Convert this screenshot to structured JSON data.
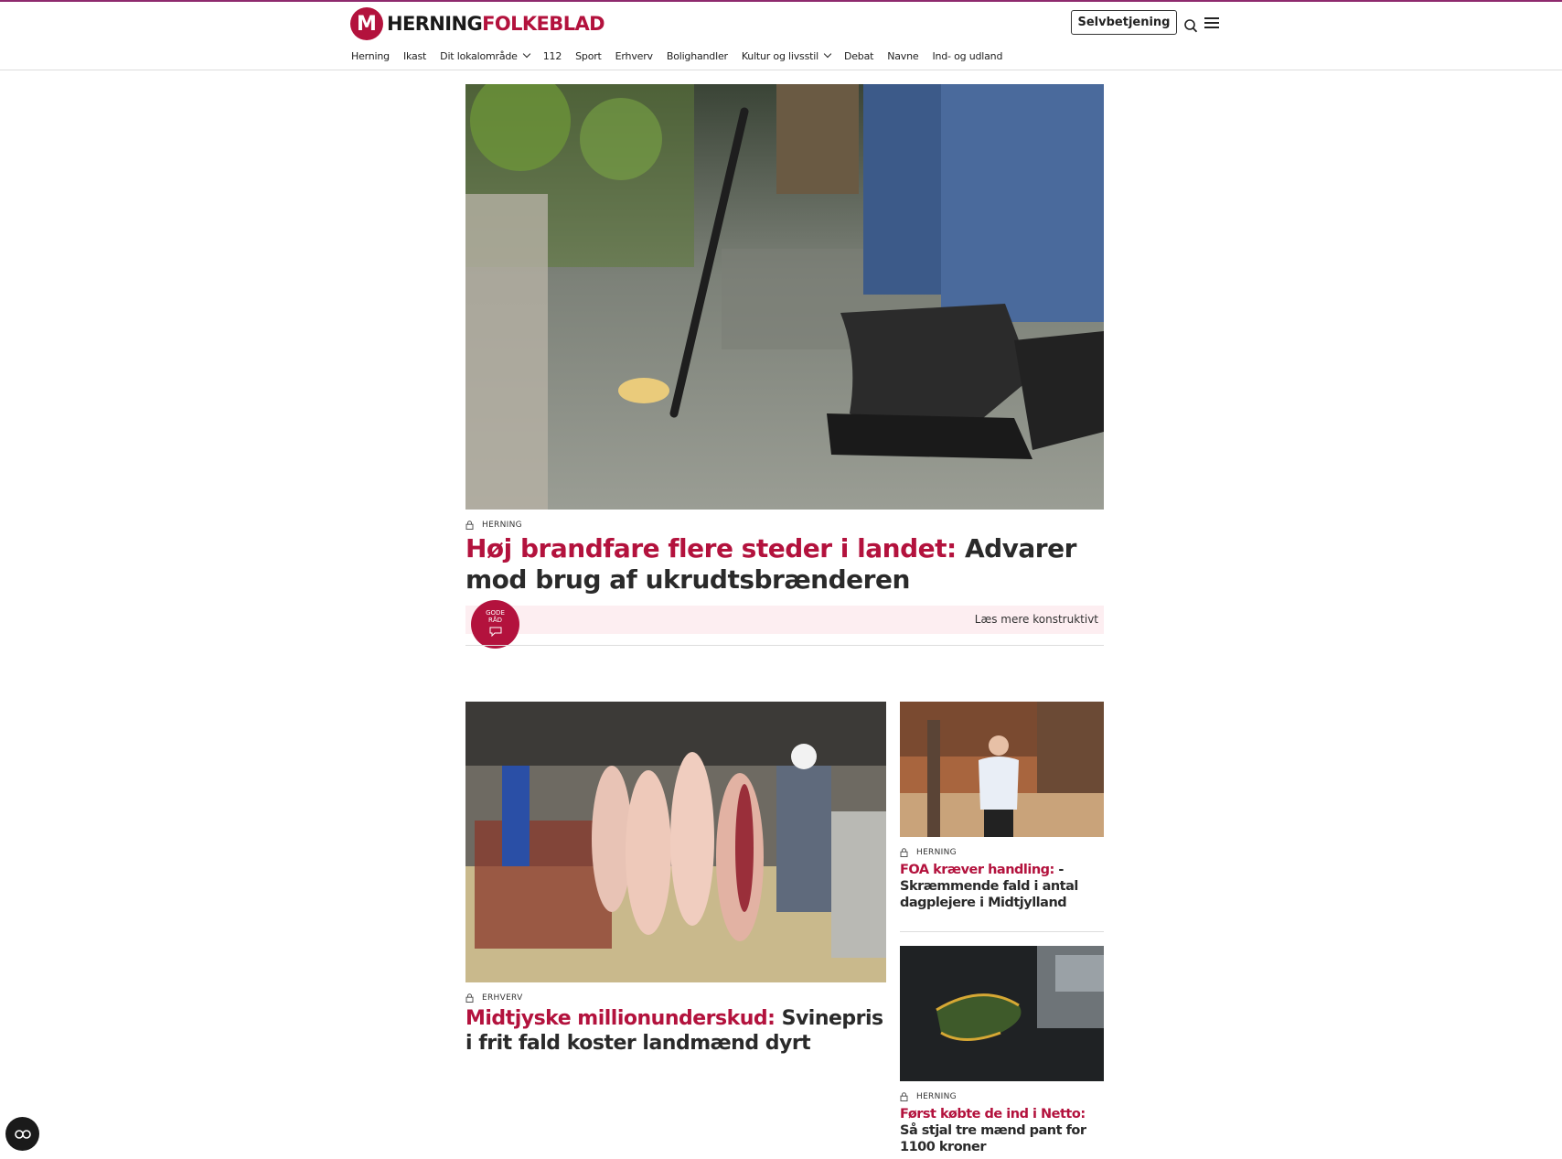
{
  "header": {
    "logo_main": "HERNING",
    "logo_accent": "FOLKEBLAD",
    "logo_mark": "M",
    "selfservice_label": "Selvbetjening"
  },
  "nav": {
    "items": [
      {
        "label": "Herning"
      },
      {
        "label": "Ikast"
      },
      {
        "label": "Dit lokalområde",
        "dropdown": true
      },
      {
        "label": "112"
      },
      {
        "label": "Sport"
      },
      {
        "label": "Erhverv"
      },
      {
        "label": "Bolighandler"
      },
      {
        "label": "Kultur og livsstil",
        "dropdown": true
      },
      {
        "label": "Debat"
      },
      {
        "label": "Navne"
      },
      {
        "label": "Ind- og udland"
      }
    ]
  },
  "lead": {
    "section": "HERNING",
    "kicker": "Høj brandfare flere steder i landet:",
    "title": " Advarer mod brug af ukrudtsbrænderen",
    "badge_line1": "GODE",
    "badge_line2": "RÅD",
    "more_label": "Læs mere konstruktivt"
  },
  "articles": [
    {
      "section": "ERHVERV",
      "kicker": "Midtjyske millionunderskud:",
      "title": " Svinepris i frit fald koster landmænd dyrt"
    },
    {
      "section": "HERNING",
      "kicker": "FOA kræver handling:",
      "title": " - Skræmmende fald i antal dagplejere i Midtjylland"
    },
    {
      "section": "HERNING",
      "kicker": "Først købte de ind i Netto:",
      "title": " Så stjal tre mænd pant for 1100 kroner"
    }
  ],
  "colors": {
    "brand": "#b3123d",
    "topline": "#8e2a6e",
    "konstruktiv_bg": "#fdeef1"
  }
}
